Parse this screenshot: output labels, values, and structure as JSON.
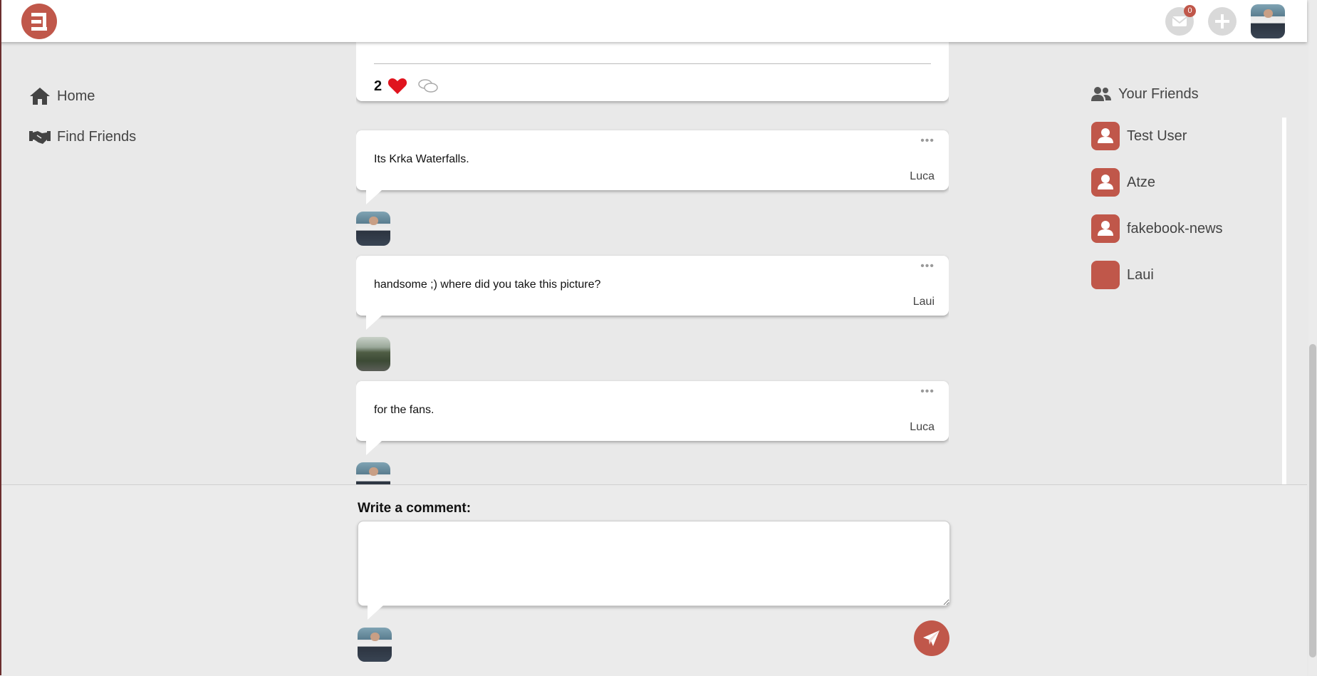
{
  "header": {
    "logo": "fakebook-logo",
    "messages_badge": "0",
    "messages_icon": "envelope-icon",
    "add_icon": "plus-icon"
  },
  "sidebar": {
    "items": [
      {
        "label": "Home",
        "icon": "home-icon"
      },
      {
        "label": "Find Friends",
        "icon": "handshake-icon"
      }
    ]
  },
  "post": {
    "like_count": "2"
  },
  "comments": [
    {
      "text": "Its Krka Waterfalls.",
      "author": "Luca"
    },
    {
      "text": "handsome ;) where did you take this picture?",
      "author": "Laui"
    },
    {
      "text": "for the fans.",
      "author": "Luca"
    }
  ],
  "friends": {
    "title": "Your Friends",
    "items": [
      {
        "name": "Test User"
      },
      {
        "name": "Atze"
      },
      {
        "name": "fakebook-news"
      },
      {
        "name": "Laui"
      }
    ]
  },
  "compose": {
    "label": "Write a comment:",
    "value": ""
  },
  "colors": {
    "accent": "#c0574a",
    "background": "#e9e9e9",
    "like": "#e0141e"
  }
}
